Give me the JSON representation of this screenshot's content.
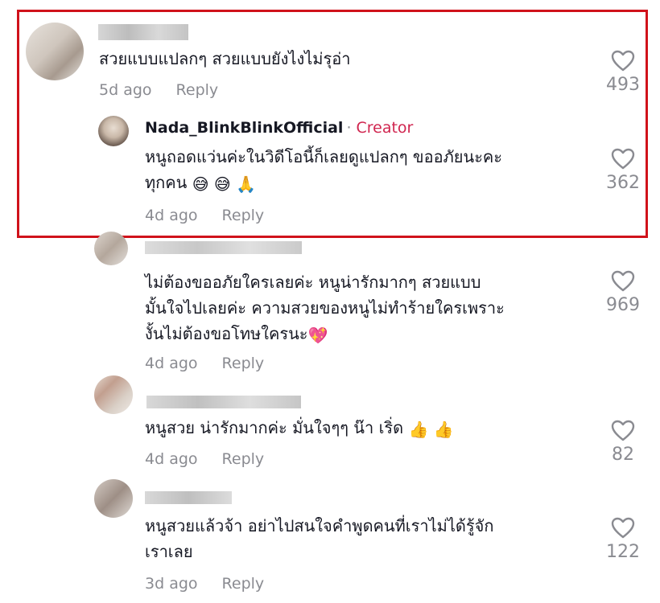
{
  "highlight_color": "#d0121b",
  "comments": [
    {
      "text_lines": [
        "สวยแบบแปลกๆ สวยแบบยังไงไม่รุอ่า"
      ],
      "time": "5d ago",
      "reply_label": "Reply",
      "likes": "493"
    },
    {
      "username": "Nada_BlinkBlinkOfficial",
      "separator": "·",
      "creator_label": "Creator",
      "text_lines": [
        "หนูถอดแว่นค่ะในวิดีโอนี้ก็เลยดูแปลกๆ ขออภัยนะคะ",
        "ทุกคน"
      ],
      "emojis": [
        "😅",
        "😅",
        "🙏"
      ],
      "time": "4d ago",
      "reply_label": "Reply",
      "likes": "362"
    },
    {
      "text_lines": [
        "ไม่ต้องขออภัยใครเลยค่ะ หนูน่ารักมากๆ สวยแบบ",
        "มั้นใจไปเลยค่ะ ความสวยของหนูไม่ทำร้ายใครเพราะ",
        "งั้นไม่ต้องขอโทษใครนะ"
      ],
      "emoji": "💖",
      "time": "4d ago",
      "reply_label": "Reply",
      "likes": "969"
    },
    {
      "text_lines": [
        "หนูสวย น่ารักมากค่ะ มั่นใจๆๆ น๊า เริ่ด"
      ],
      "emojis": [
        "👍",
        "👍"
      ],
      "time": "4d ago",
      "reply_label": "Reply",
      "likes": "82"
    },
    {
      "text_lines": [
        "หนูสวยแล้วจ้า อย่าไปสนใจคำพูดคนที่เราไม่ได้รู้จัก",
        "เราเลย"
      ],
      "time": "3d ago",
      "reply_label": "Reply",
      "likes": "122"
    }
  ]
}
